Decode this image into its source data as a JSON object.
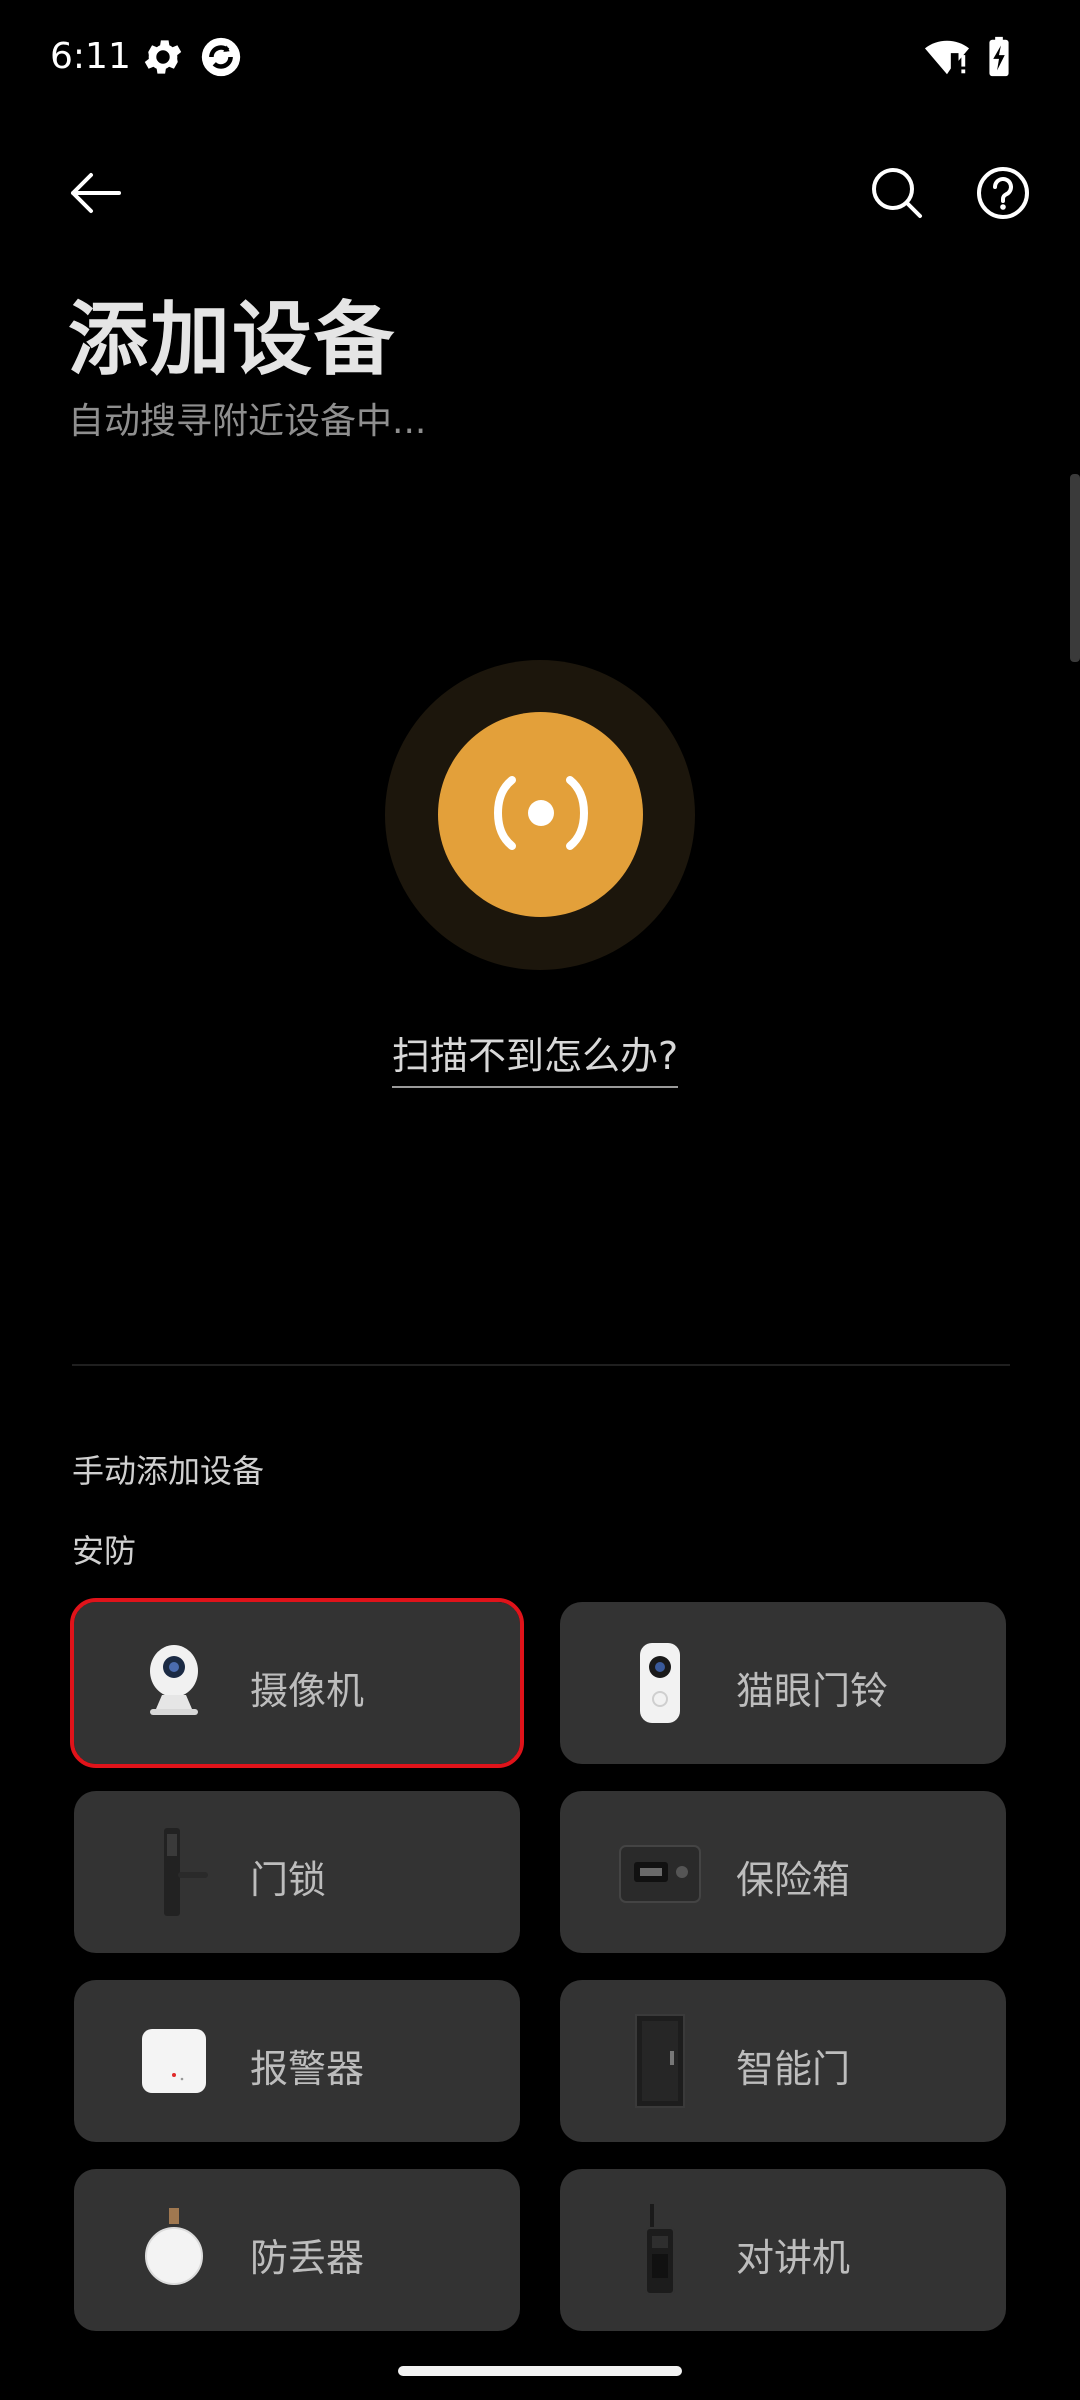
{
  "status_bar": {
    "time": "6:11",
    "icons": [
      "gear-icon",
      "app-sync-icon",
      "wifi-alert-icon",
      "battery-charging-icon"
    ]
  },
  "app_bar": {
    "back_icon": "arrow-left-icon",
    "search_icon": "search-icon",
    "help_icon": "help-circle-icon"
  },
  "header": {
    "title": "添加设备",
    "subtitle": "自动搜寻附近设备中..."
  },
  "scan": {
    "icon": "broadcast-icon",
    "color": "#e3a03a",
    "help_link": "扫描不到怎么办?"
  },
  "manual": {
    "section_title": "手动添加设备",
    "category_title": "安防",
    "devices": [
      {
        "label": "摄像机",
        "icon": "camera-icon",
        "selected": true
      },
      {
        "label": "猫眼门铃",
        "icon": "doorbell-icon",
        "selected": false
      },
      {
        "label": "门锁",
        "icon": "door-lock-icon",
        "selected": false
      },
      {
        "label": "保险箱",
        "icon": "safe-icon",
        "selected": false
      },
      {
        "label": "报警器",
        "icon": "alarm-icon",
        "selected": false
      },
      {
        "label": "智能门",
        "icon": "smart-door-icon",
        "selected": false
      },
      {
        "label": "防丢器",
        "icon": "tracker-tag-icon",
        "selected": false
      },
      {
        "label": "对讲机",
        "icon": "walkie-talkie-icon",
        "selected": false
      }
    ]
  },
  "colors": {
    "background": "#000000",
    "card": "#333333",
    "accent": "#e3a03a",
    "selection": "#e0131a"
  }
}
